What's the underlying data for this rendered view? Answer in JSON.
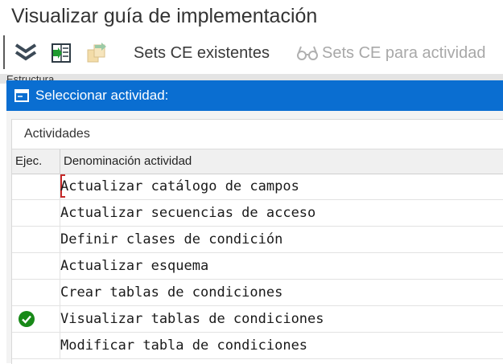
{
  "window": {
    "title": "Visualizar guía de implementación"
  },
  "toolbar": {
    "items": [
      {
        "icon": "expand-all-icon",
        "enabled": true
      },
      {
        "icon": "select-activity-icon",
        "enabled": true
      },
      {
        "icon": "copy-note-icon",
        "enabled": false
      }
    ],
    "sets_ce_existentes": "Sets CE existentes",
    "sets_ce_para_actividad": "Sets CE para actividad"
  },
  "structure_label": "Estructura",
  "dialog": {
    "title": "Seleccionar actividad:",
    "section_title": "Actividades",
    "columns": {
      "ejec": "Ejec.",
      "denominacion": "Denominación actividad"
    },
    "rows": [
      {
        "label": "Actualizar catálogo de campos",
        "executed": false,
        "focused": true
      },
      {
        "label": "Actualizar secuencias de acceso",
        "executed": false,
        "focused": false
      },
      {
        "label": "Definir clases de condición",
        "executed": false,
        "focused": false
      },
      {
        "label": "Actualizar esquema",
        "executed": false,
        "focused": false
      },
      {
        "label": "Crear tablas de condiciones",
        "executed": false,
        "focused": false
      },
      {
        "label": "Visualizar tablas de condiciones",
        "executed": true,
        "focused": false
      },
      {
        "label": "Modificar tabla de condiciones",
        "executed": false,
        "focused": false
      }
    ]
  },
  "colors": {
    "header_blue": "#0a6ed1",
    "check_green": "#188918"
  }
}
